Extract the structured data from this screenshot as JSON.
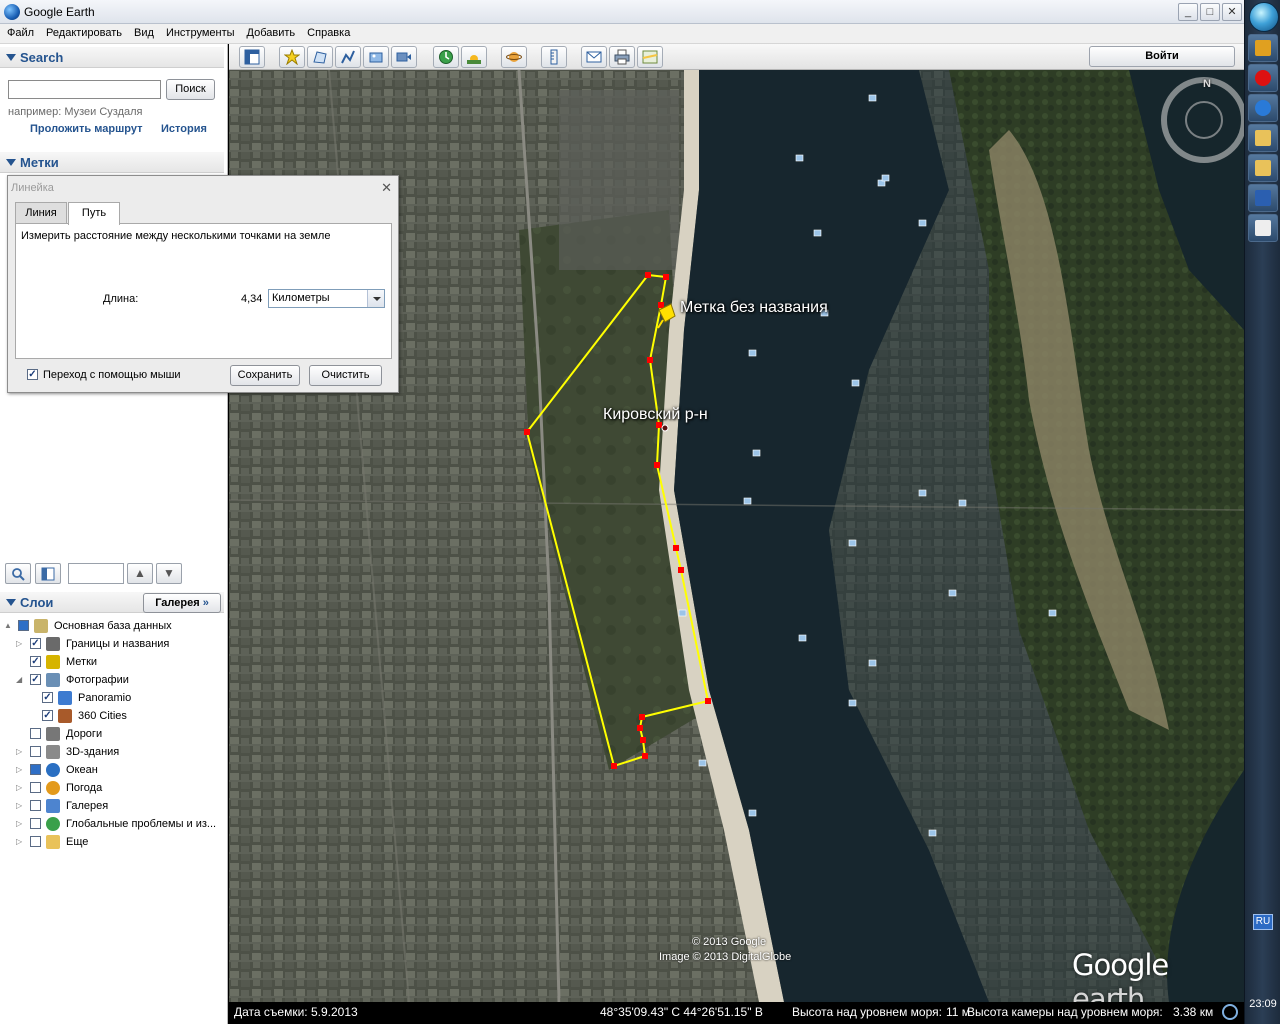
{
  "window": {
    "title": "Google Earth",
    "controls": [
      "_",
      "□",
      "✕"
    ]
  },
  "menu": [
    "Файл",
    "Редактировать",
    "Вид",
    "Инструменты",
    "Добавить",
    "Справка"
  ],
  "search": {
    "header": "Search",
    "input_value": "",
    "button": "Поиск",
    "hint": "например: Музеи Суздаля",
    "route_link": "Проложить маршрут",
    "history_link": "История"
  },
  "places": {
    "header": "Метки"
  },
  "ruler": {
    "title": "Линейка",
    "tabs": [
      "Линия",
      "Путь"
    ],
    "active_tab": "Путь",
    "description": "Измерить расстояние между несколькими точками на земле",
    "length_label": "Длина:",
    "length_value": "4,34",
    "unit": "Километры",
    "mouse_nav_label": "Переход с помощью мыши",
    "mouse_nav_checked": true,
    "save_button": "Сохранить",
    "clear_button": "Очистить"
  },
  "layers": {
    "header": "Слои",
    "gallery_button": "Галерея",
    "items": [
      {
        "label": "Основная база данных",
        "checked": "partial",
        "icon": "database-icon",
        "level": 0,
        "expander": "▲"
      },
      {
        "label": "Границы и названия",
        "checked": true,
        "icon": "flag-icon",
        "level": 1,
        "expander": "▷"
      },
      {
        "label": "Метки",
        "checked": true,
        "icon": "placemark-icon",
        "level": 1,
        "expander": ""
      },
      {
        "label": "Фотографии",
        "checked": true,
        "icon": "photo-icon",
        "level": 1,
        "expander": "◢"
      },
      {
        "label": "Panoramio",
        "checked": true,
        "icon": "panoramio-icon",
        "level": 2,
        "expander": ""
      },
      {
        "label": "360 Cities",
        "checked": true,
        "icon": "cities-icon",
        "level": 2,
        "expander": ""
      },
      {
        "label": "Дороги",
        "checked": false,
        "icon": "roads-icon",
        "level": 1,
        "expander": ""
      },
      {
        "label": "3D-здания",
        "checked": false,
        "icon": "buildings-icon",
        "level": 1,
        "expander": "▷"
      },
      {
        "label": "Океан",
        "checked": "partial",
        "icon": "ocean-icon",
        "level": 1,
        "expander": "▷"
      },
      {
        "label": "Погода",
        "checked": false,
        "icon": "weather-icon",
        "level": 1,
        "expander": "▷"
      },
      {
        "label": "Галерея",
        "checked": false,
        "icon": "star-icon",
        "level": 1,
        "expander": "▷"
      },
      {
        "label": "Глобальные проблемы и из...",
        "checked": false,
        "icon": "globe-icon",
        "level": 1,
        "expander": "▷"
      },
      {
        "label": "Еще",
        "checked": false,
        "icon": "folder-icon",
        "level": 1,
        "expander": "▷"
      }
    ]
  },
  "map_toolbar": {
    "login_button": "Войти"
  },
  "map": {
    "placemark_label": "Метка без названия",
    "district_label": "Кировский р-н",
    "copyright_1": "© 2013 Google",
    "copyright_2": "Image © 2013 DigitalGlobe",
    "logo_a": "Google",
    "logo_b": "earth",
    "compass_n": "N"
  },
  "status": {
    "date": "Дата съемки: 5.9.2013",
    "coords": "48°35'09.43\" С  44°26'51.15\" В",
    "elevation": "Высота над уровнем моря:",
    "elevation_value": "11 м",
    "eye_alt": "Высота камеры над уровнем моря:",
    "eye_alt_value": "3.38 км"
  },
  "taskbar": {
    "lang": "RU",
    "clock": "23:09"
  },
  "colors": {
    "accent": "#25548f",
    "path": "#ffff00",
    "vertex": "#ff0000"
  }
}
